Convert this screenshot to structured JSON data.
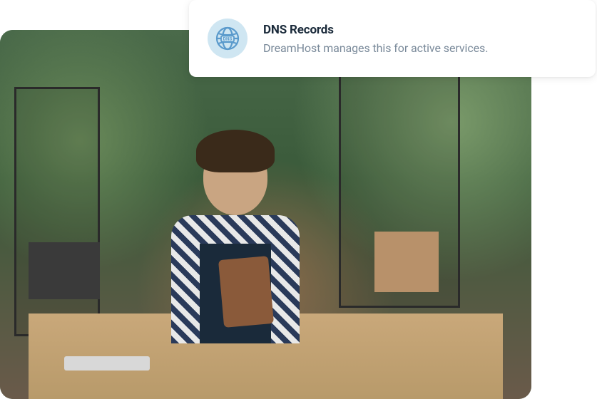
{
  "card": {
    "title": "DNS Records",
    "description": "DreamHost manages this for active services.",
    "icon_label": "DNS"
  },
  "colors": {
    "icon_bg": "#cfe6f2",
    "icon_stroke": "#5a9acc",
    "title": "#1a2a3a",
    "desc": "#7a8a9a"
  }
}
